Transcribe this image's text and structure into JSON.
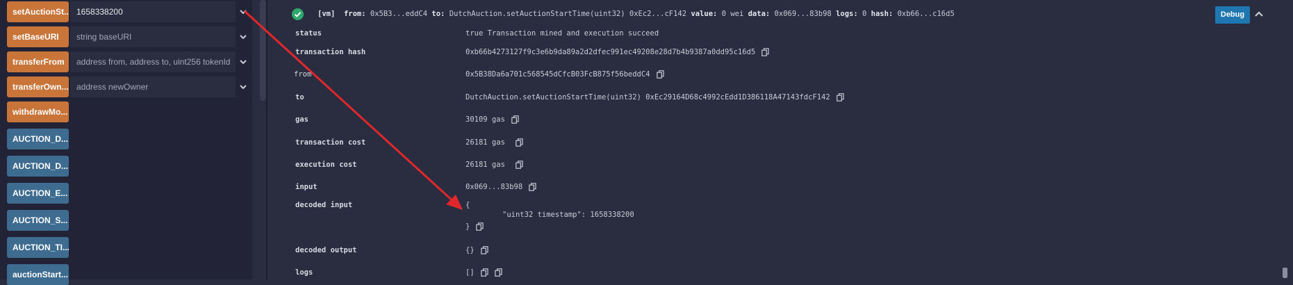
{
  "functions": [
    {
      "label": "setAuctionSt...",
      "value": "1658338200",
      "placeholder": "",
      "color": "orange",
      "expand": true
    },
    {
      "label": "setBaseURI",
      "value": "",
      "placeholder": "string baseURI",
      "color": "orange",
      "expand": true
    },
    {
      "label": "transferFrom",
      "value": "",
      "placeholder": "address from, address to, uint256 tokenId",
      "color": "orange",
      "expand": true
    },
    {
      "label": "transferOwn...",
      "value": "",
      "placeholder": "address newOwner",
      "color": "orange",
      "expand": true
    },
    {
      "label": "withdrawMo...",
      "value": "",
      "placeholder": "",
      "color": "orange",
      "expand": false
    },
    {
      "label": "AUCTION_D...",
      "color": "blue"
    },
    {
      "label": "AUCTION_D...",
      "color": "blue"
    },
    {
      "label": "AUCTION_E...",
      "color": "blue"
    },
    {
      "label": "AUCTION_S...",
      "color": "blue"
    },
    {
      "label": "AUCTION_TI...",
      "color": "blue"
    },
    {
      "label": "auctionStart...",
      "color": "blue"
    }
  ],
  "tx": {
    "tag": "[vm]",
    "from_label": "from:",
    "from": "0x5B3...eddC4",
    "to_label": "to:",
    "to": "DutchAuction.setAuctionStartTime(uint32) 0xEc2...cF142",
    "value_label": "value:",
    "value": "0 wei",
    "data_label": "data:",
    "data": "0x069...83b98",
    "logs_label": "logs:",
    "logs": "0",
    "hash_label": "hash:",
    "hash": "0xb66...c16d5"
  },
  "debug_label": "Debug",
  "details": {
    "status_label": "status",
    "status": "true Transaction mined and execution succeed",
    "tx_hash_label": "transaction hash",
    "tx_hash": "0xb66b4273127f9c3e6b9da89a2d2dfec991ec49208e28d7b4b9387a0dd95c16d5",
    "from_label": "from",
    "from": "0x5B38Da6a701c568545dCfcB03FcB875f56beddC4",
    "to_label": "to",
    "to": "DutchAuction.setAuctionStartTime(uint32) 0xEc29164D68c4992cEdd1D386118A47143fdcF142",
    "gas_label": "gas",
    "gas": "30109 gas",
    "tx_cost_label": "transaction cost",
    "tx_cost": "26181 gas",
    "exec_cost_label": "execution cost",
    "exec_cost": "26181 gas",
    "input_label": "input",
    "input": "0x069...83b98",
    "decoded_input_label": "decoded input",
    "decoded_open": "{",
    "decoded_line": "\"uint32 timestamp\": 1658338200",
    "decoded_close": "}",
    "decoded_output_label": "decoded output",
    "decoded_output": "{}",
    "logs_label": "logs",
    "logs": "[]"
  },
  "colors": {
    "orange": "#c97539",
    "blue": "#3e6c91",
    "success": "#2fa86d",
    "debug": "#1e77b0",
    "arrow": "#e0282c"
  },
  "icons": [
    "chevron-down-icon",
    "check-circle-icon",
    "chevron-up-icon",
    "copy-icon"
  ]
}
